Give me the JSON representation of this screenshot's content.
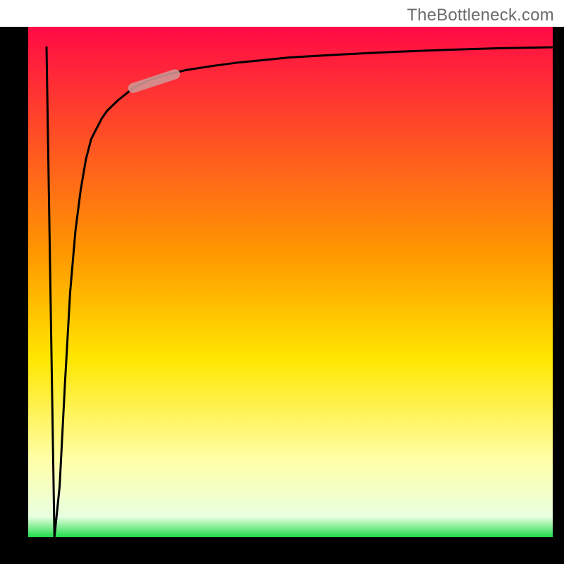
{
  "watermark": "TheBottleneck.com",
  "chart_data": {
    "type": "line",
    "title": "",
    "xlabel": "",
    "ylabel": "",
    "xlim": [
      0,
      100
    ],
    "ylim": [
      0,
      100
    ],
    "x": [
      5,
      6,
      7,
      8,
      9,
      10,
      11,
      12,
      13,
      14,
      15,
      17,
      20,
      23,
      26,
      30,
      35,
      40,
      45,
      50,
      55,
      60,
      70,
      80,
      90,
      100
    ],
    "values": [
      0,
      10,
      30,
      48,
      60,
      68,
      74,
      78,
      80,
      82,
      83.5,
      85.5,
      88,
      89.5,
      90.5,
      91.5,
      92.3,
      93,
      93.5,
      94,
      94.3,
      94.6,
      95.1,
      95.5,
      95.8,
      96
    ],
    "highlight_segment": {
      "x_start": 20,
      "x_end": 28,
      "y_start": 88,
      "y_end": 90.7
    },
    "gradient_stops": [
      {
        "offset": 0,
        "color": "#ff0a46"
      },
      {
        "offset": 45,
        "color": "#ff9a00"
      },
      {
        "offset": 65,
        "color": "#ffe600"
      },
      {
        "offset": 85,
        "color": "#ffffaa"
      },
      {
        "offset": 96,
        "color": "#e8ffe0"
      },
      {
        "offset": 100,
        "color": "#1fdc4a"
      }
    ],
    "series_color": "#000000",
    "highlight_color": "#d09592"
  }
}
